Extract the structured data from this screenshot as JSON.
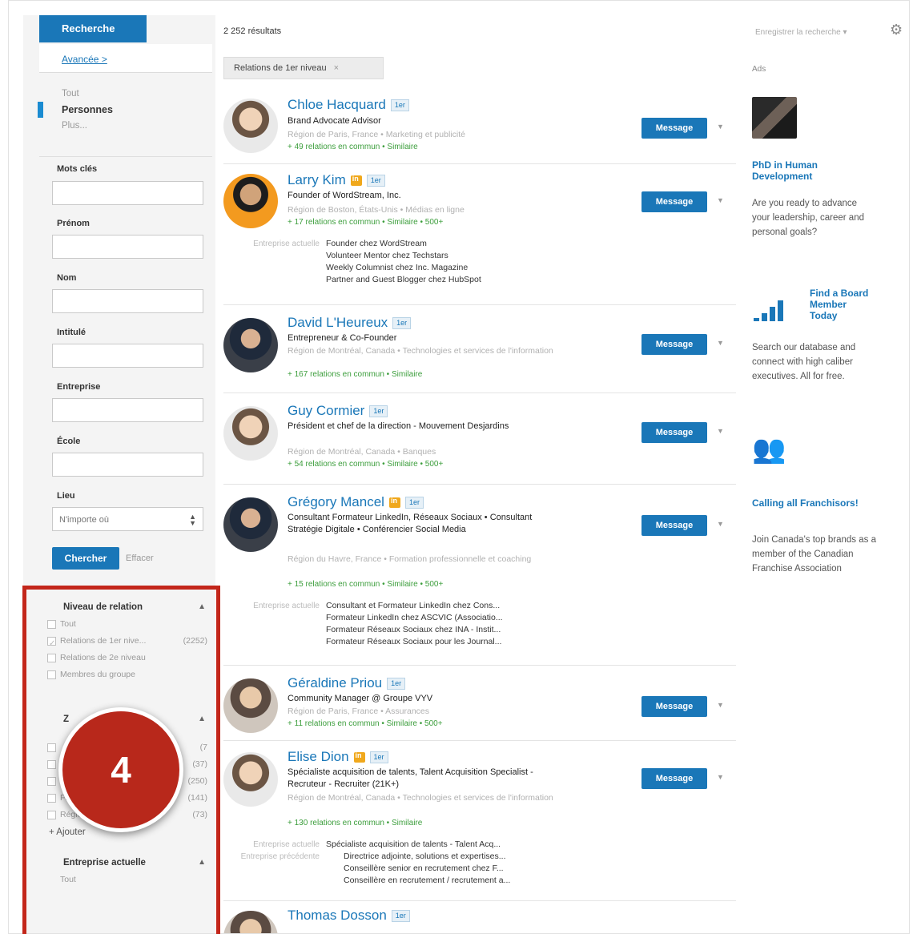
{
  "sidebar": {
    "search_tab": "Recherche",
    "advanced_link": "Avancée >",
    "scopes": [
      {
        "label": "Tout",
        "active": false
      },
      {
        "label": "Personnes",
        "active": true
      },
      {
        "label": "Plus...",
        "active": false
      }
    ],
    "fields": {
      "keywords_label": "Mots clés",
      "firstname_label": "Prénom",
      "lastname_label": "Nom",
      "title_label": "Intitulé",
      "company_label": "Entreprise",
      "school_label": "École",
      "location_label": "Lieu",
      "location_value": "N'importe où"
    },
    "search_button": "Chercher",
    "clear_link": "Effacer",
    "relation_facet": {
      "title": "Niveau de relation",
      "items": [
        {
          "label": "Tout",
          "count": "",
          "checked": false
        },
        {
          "label": "Relations de 1er nive...",
          "count": "(2252)",
          "checked": true
        },
        {
          "label": "Relations de 2e niveau",
          "count": "",
          "checked": false
        },
        {
          "label": "Membres du groupe",
          "count": "",
          "checked": false
        }
      ]
    },
    "location_facet": {
      "title": "Z",
      "items": [
        {
          "label": "",
          "count": "(7",
          "checked": false
        },
        {
          "label": "F",
          "count": "(37)",
          "checked": false
        },
        {
          "label": "Qu",
          "count": "(250)",
          "checked": false
        },
        {
          "label": "France",
          "count": "(141)",
          "checked": false
        },
        {
          "label": "Région de Paris, France",
          "count": "(73)",
          "checked": false
        }
      ],
      "add_label": "+ Ajouter"
    },
    "company_facet": {
      "title": "Entreprise actuelle",
      "items": [
        {
          "label": "Tout",
          "count": "",
          "checked": false
        }
      ]
    },
    "badge_number": "4"
  },
  "main": {
    "results_count": "2 252 résultats",
    "filter_chip": "Relations de 1er niveau",
    "filter_chip_close": "×",
    "message_label": "Message",
    "results": [
      {
        "name": "Chloe Hacquard",
        "degree": "1er",
        "premium": false,
        "headline": "Brand Advocate Advisor",
        "location": "Région de Paris, France • Marketing et publicité",
        "common": "+ 49 relations en commun • Similaire",
        "extra_label": "",
        "extra": []
      },
      {
        "name": "Larry Kim",
        "degree": "1er",
        "premium": true,
        "headline": "Founder of WordStream, Inc.",
        "location": "Région de Boston, États-Unis • Médias en ligne",
        "common": "+ 17 relations en commun • Similaire • 500+",
        "extra_label": "Entreprise actuelle",
        "extra": [
          "Founder chez WordStream",
          "Volunteer Mentor chez Techstars",
          "Weekly Columnist chez Inc. Magazine",
          "Partner and Guest Blogger chez HubSpot"
        ]
      },
      {
        "name": "David L'Heureux",
        "degree": "1er",
        "premium": false,
        "headline": "Entrepreneur & Co-Founder",
        "location": "Région de Montréal, Canada • Technologies et services de l'information",
        "common": "+ 167 relations en commun • Similaire",
        "extra_label": "",
        "extra": []
      },
      {
        "name": "Guy Cormier",
        "degree": "1er",
        "premium": false,
        "headline": "Président et chef de la direction - Mouvement Desjardins",
        "location": "Région de Montréal, Canada • Banques",
        "common": "+ 54 relations en commun • Similaire • 500+",
        "extra_label": "",
        "extra": []
      },
      {
        "name": "Grégory Mancel",
        "degree": "1er",
        "premium": true,
        "headline": "Consultant Formateur LinkedIn, Réseaux Sociaux • Consultant Stratégie Digitale • Conférencier Social Media",
        "location": "Région du Havre, France • Formation professionnelle et coaching",
        "common": "+ 15 relations en commun • Similaire • 500+",
        "extra_label": "Entreprise actuelle",
        "extra": [
          "Consultant et Formateur LinkedIn chez Cons...",
          "Formateur LinkedIn chez ASCVIC (Associatio...",
          "Formateur Réseaux Sociaux chez INA - Instit...",
          "Formateur Réseaux Sociaux pour les Journal..."
        ]
      },
      {
        "name": "Géraldine Priou",
        "degree": "1er",
        "premium": false,
        "headline": "Community Manager @ Groupe VYV",
        "location": "Région de Paris, France • Assurances",
        "common": "+ 11 relations en commun • Similaire • 500+",
        "extra_label": "",
        "extra": []
      },
      {
        "name": "Elise Dion",
        "degree": "1er",
        "premium": true,
        "headline": "Spécialiste acquisition de talents, Talent Acquisition Specialist - Recruteur - Recruiter (21K+)",
        "location": "Région de Montréal, Canada • Technologies et services de l'information",
        "common": "+ 130 relations en commun • Similaire",
        "extra_label": "Entreprise actuelle",
        "extra_label_2": "Entreprise précédente",
        "extra": [
          "Spécialiste acquisition de talents - Talent Acq...",
          "Directrice adjointe, solutions et expertises...",
          "Conseillère senior en recrutement chez F...",
          "Conseillère en recrutement / recrutement a..."
        ]
      },
      {
        "name": "Thomas Dosson",
        "degree": "1er",
        "premium": false,
        "headline": "",
        "location": "",
        "common": "",
        "extra_label": "",
        "extra": []
      }
    ]
  },
  "right": {
    "save_search": "Enregistrer la recherche",
    "ads_label": "Ads",
    "ads": [
      {
        "title": "PhD in Human Development",
        "body": "Are you ready to advance your leadership, career and personal goals?"
      },
      {
        "title": "Find a Board Member Today",
        "body": "Search our database and connect with high caliber executives. All for free."
      },
      {
        "title": "Calling all Franchisors!",
        "body": "Join Canada's top brands as a member of the Canadian Franchise Association"
      }
    ]
  },
  "colors": {
    "linkedin_blue": "#1a77b8",
    "highlight_red": "#c3261a",
    "green": "#3c9e3c"
  }
}
